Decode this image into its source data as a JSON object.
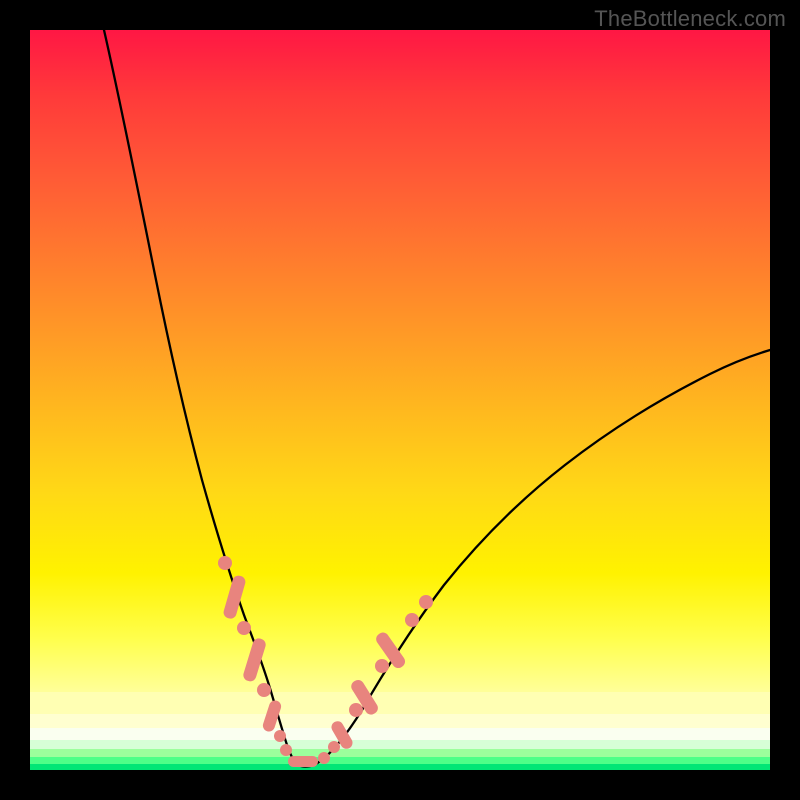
{
  "watermark": "TheBottleneck.com",
  "chart_data": {
    "type": "line",
    "title": "",
    "xlabel": "",
    "ylabel": "",
    "xlim": [
      0,
      100
    ],
    "ylim": [
      0,
      100
    ],
    "grid": false,
    "series": [
      {
        "name": "bottleneck-curve",
        "x": [
          10,
          12,
          14,
          16,
          18,
          20,
          22,
          24,
          26,
          28,
          30,
          32,
          33,
          34,
          35,
          36,
          37,
          38,
          40,
          42,
          46,
          52,
          60,
          70,
          82,
          96,
          100
        ],
        "y": [
          100,
          88,
          77,
          66,
          56,
          47,
          39,
          32,
          26,
          21,
          16,
          11,
          8,
          5,
          2,
          1,
          1,
          1,
          3,
          7,
          14,
          22,
          31,
          40,
          48,
          55,
          57
        ]
      }
    ],
    "highlight_clusters": [
      {
        "name": "left-arm-dots",
        "x_range": [
          26,
          33
        ],
        "y_range": [
          7,
          28
        ]
      },
      {
        "name": "valley-dots",
        "x_range": [
          33,
          38
        ],
        "y_range": [
          1,
          5
        ]
      },
      {
        "name": "right-arm-dots",
        "x_range": [
          38,
          46
        ],
        "y_range": [
          2,
          18
        ]
      }
    ],
    "background": {
      "type": "vertical-gradient",
      "stops": [
        {
          "pos": 0,
          "color": "#ff1744"
        },
        {
          "pos": 50,
          "color": "#ffba1e"
        },
        {
          "pos": 85,
          "color": "#ffff4d"
        },
        {
          "pos": 97,
          "color": "#9cff9c"
        },
        {
          "pos": 100,
          "color": "#00e676"
        }
      ]
    }
  }
}
